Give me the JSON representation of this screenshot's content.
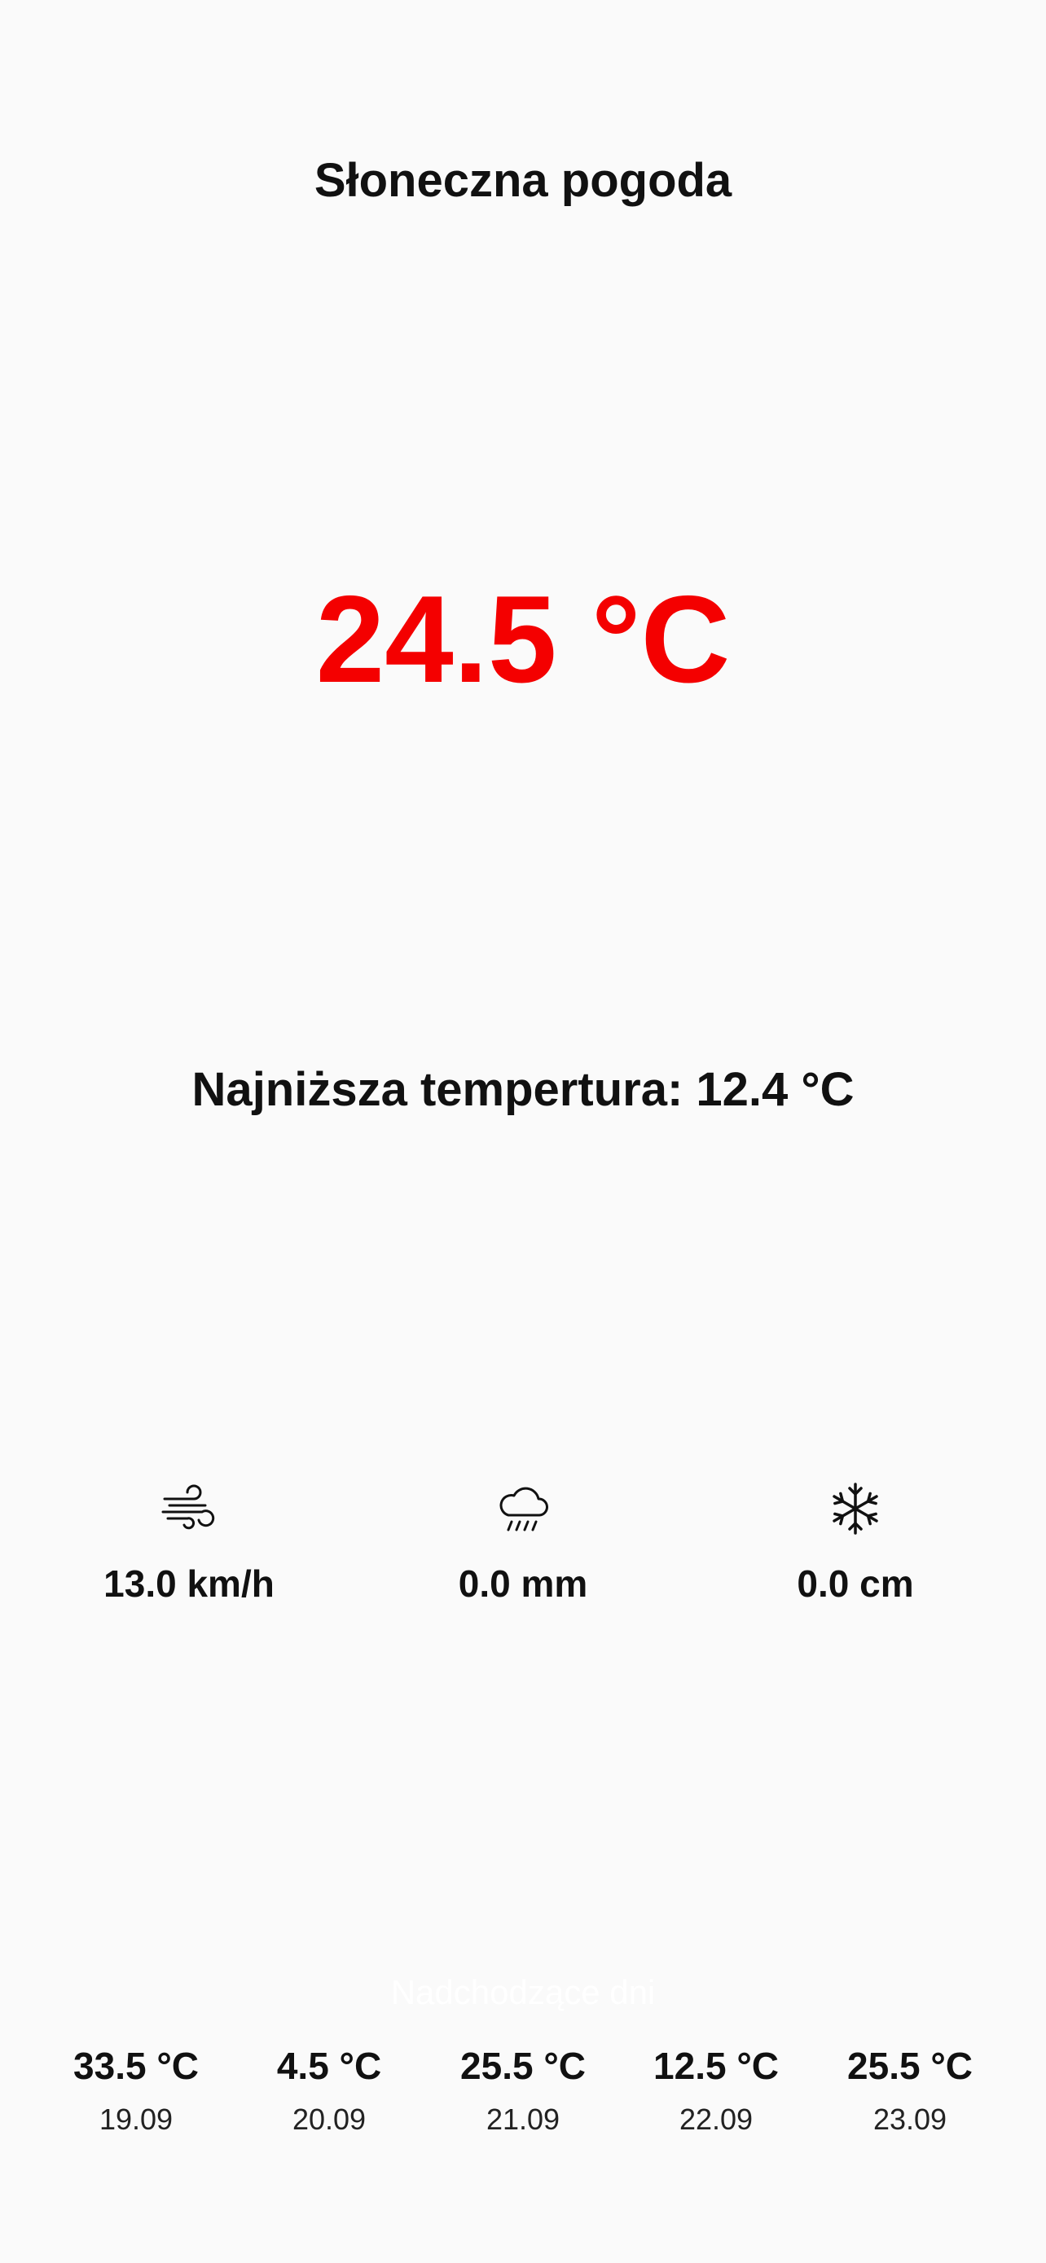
{
  "header": {
    "title": "Słoneczna pogoda"
  },
  "current": {
    "temperature": "24.5 °C",
    "temperature_color": "#f40000",
    "min_temperature": "Najniższa tempertura: 12.4 °C"
  },
  "stats": [
    {
      "icon": "wind-icon",
      "value": "13.0 km/h"
    },
    {
      "icon": "cloud-rain-icon",
      "value": "0.0 mm"
    },
    {
      "icon": "snowflake-icon",
      "value": "0.0 cm"
    }
  ],
  "upcoming": {
    "heading": "Nadchodzące dni",
    "days": [
      {
        "temp": "33.5 °C",
        "date": "19.09"
      },
      {
        "temp": "4.5 °C",
        "date": "20.09"
      },
      {
        "temp": "25.5 °C",
        "date": "21.09"
      },
      {
        "temp": "12.5 °C",
        "date": "22.09"
      },
      {
        "temp": "25.5 °C",
        "date": "23.09"
      }
    ]
  }
}
